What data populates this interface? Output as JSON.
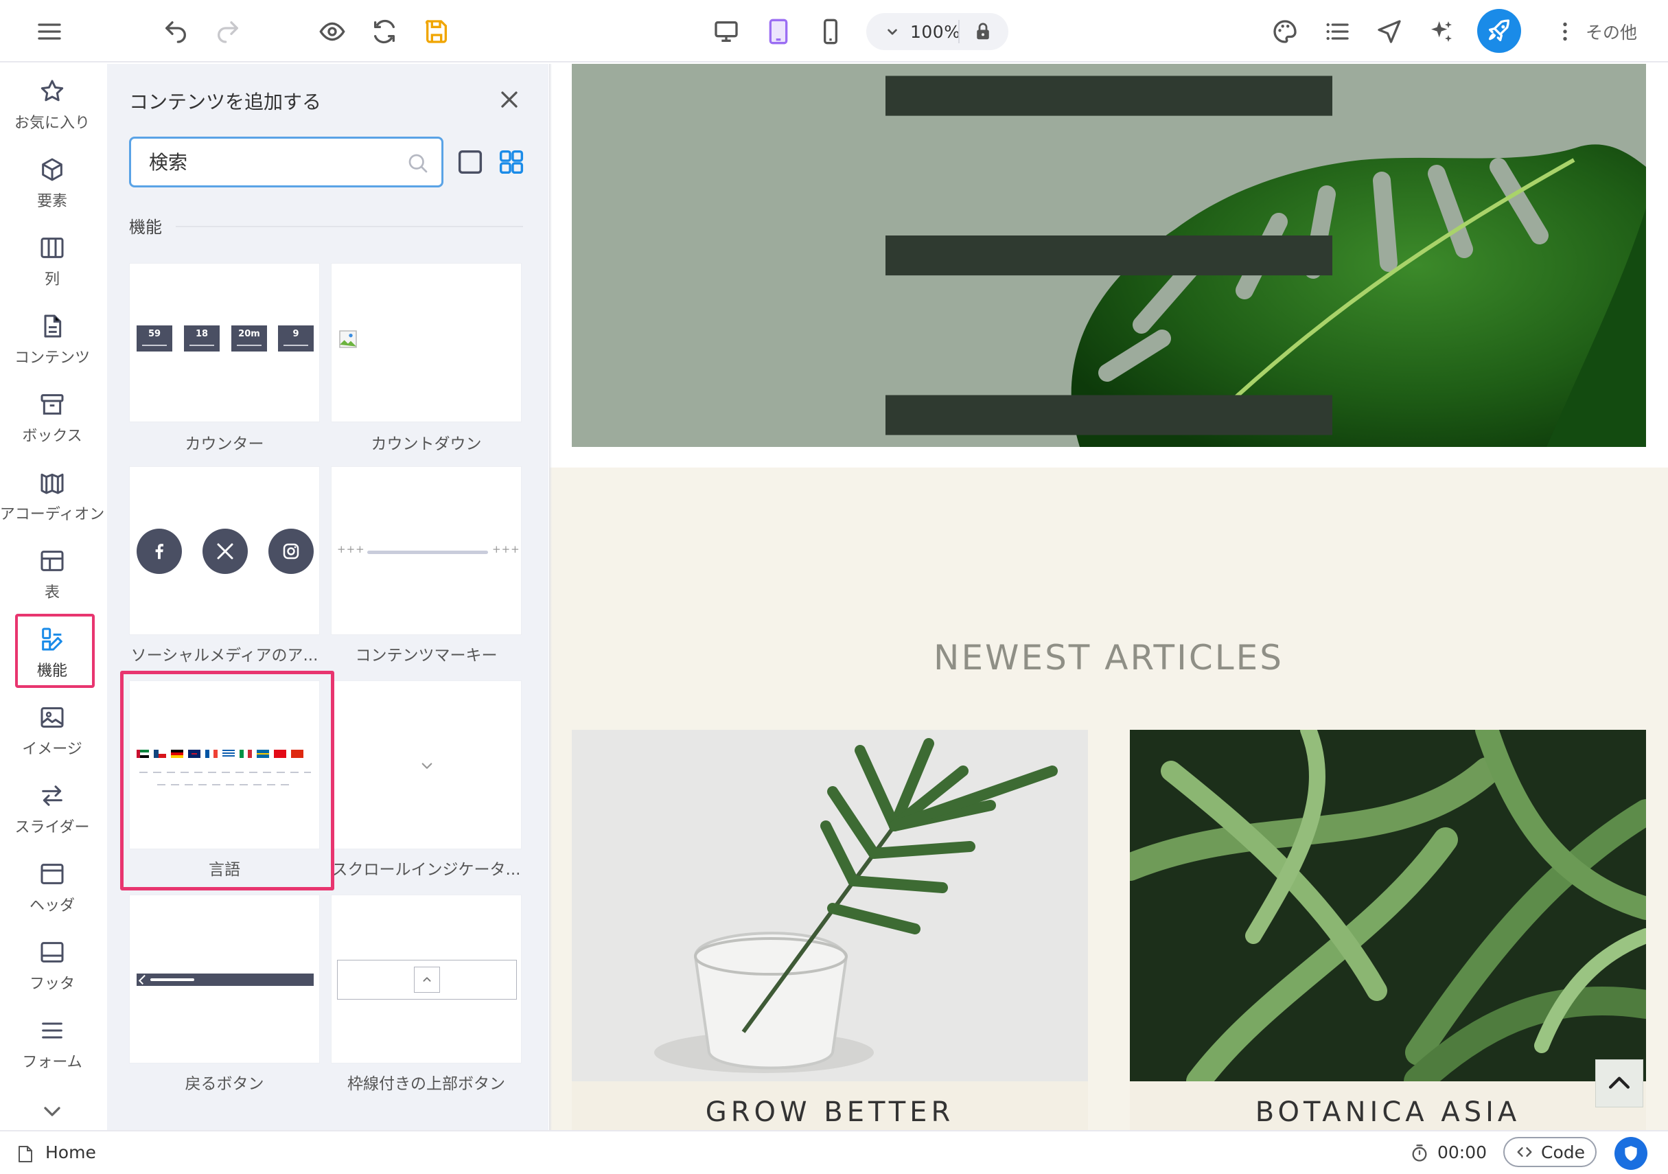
{
  "toolbar": {
    "zoom": "100%",
    "more_label": "その他",
    "accent_color": "#1a8be8",
    "active_device_color": "#9b6ef3",
    "save_color": "#f0a500"
  },
  "sidebar": {
    "items": [
      {
        "label": "お気に入り",
        "icon": "star-icon"
      },
      {
        "label": "要素",
        "icon": "cube-icon"
      },
      {
        "label": "列",
        "icon": "columns-icon"
      },
      {
        "label": "コンテンツ",
        "icon": "document-icon"
      },
      {
        "label": "ボックス",
        "icon": "box-icon"
      },
      {
        "label": "アコーディオン",
        "icon": "accordion-icon"
      },
      {
        "label": "表",
        "icon": "table-icon"
      },
      {
        "label": "機能",
        "icon": "features-icon"
      },
      {
        "label": "イメージ",
        "icon": "image-icon"
      },
      {
        "label": "スライダー",
        "icon": "slider-icon"
      },
      {
        "label": "ヘッダ",
        "icon": "header-icon"
      },
      {
        "label": "フッタ",
        "icon": "footer-icon"
      },
      {
        "label": "フォーム",
        "icon": "form-icon"
      }
    ],
    "active_index": 7
  },
  "panel": {
    "title": "コンテンツを追加する",
    "search_placeholder": "検索",
    "section": "機能",
    "cards": [
      {
        "label": "カウンター",
        "counter_values": [
          "59",
          "18",
          "20m",
          "9"
        ]
      },
      {
        "label": "カウントダウン"
      },
      {
        "label": "ソーシャルメディアのア..."
      },
      {
        "label": "コンテンツマーキー",
        "marquee_text": "+++"
      },
      {
        "label": "言語"
      },
      {
        "label": "スクロールインジケータ..."
      },
      {
        "label": "戻るボタン"
      },
      {
        "label": "枠線付きの上部ボタン"
      }
    ]
  },
  "canvas": {
    "section_title": "NEWEST ARTICLES",
    "articles": [
      {
        "title": "GROW BETTER"
      },
      {
        "title": "BOTANICA ASIA"
      }
    ]
  },
  "status": {
    "page": "Home",
    "timer": "00:00",
    "code_label": "Code"
  },
  "highlight_color": "#e8356f"
}
